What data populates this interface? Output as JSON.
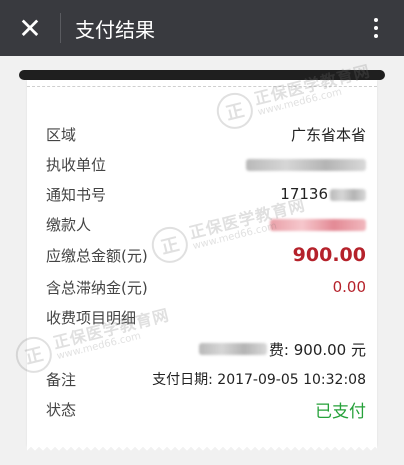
{
  "header": {
    "close_glyph": "✕",
    "title": "支付结果"
  },
  "receipt": {
    "rows": [
      {
        "label": "区域",
        "value": "广东省本省"
      },
      {
        "label": "执收单位",
        "value": ""
      },
      {
        "label": "通知书号",
        "value": "17136"
      },
      {
        "label": "缴款人",
        "value": ""
      },
      {
        "label": "应缴总金额(元)",
        "value": "900.00"
      },
      {
        "label": "含总滞纳金(元)",
        "value": "0.00"
      },
      {
        "label": "收费项目明细",
        "value": ""
      },
      {
        "label": "",
        "value": "费: 900.00 元"
      },
      {
        "label": "备注",
        "value": "支付日期: 2017-09-05 10:32:08"
      },
      {
        "label": "状态",
        "value": "已支付"
      }
    ]
  },
  "watermark": {
    "text": "正保医学教育网",
    "url": "www.med66.com",
    "seal_glyph": "正"
  },
  "colors": {
    "topbar": "#393a3f",
    "amount_red": "#b5222b",
    "paid_green": "#26a13a"
  }
}
